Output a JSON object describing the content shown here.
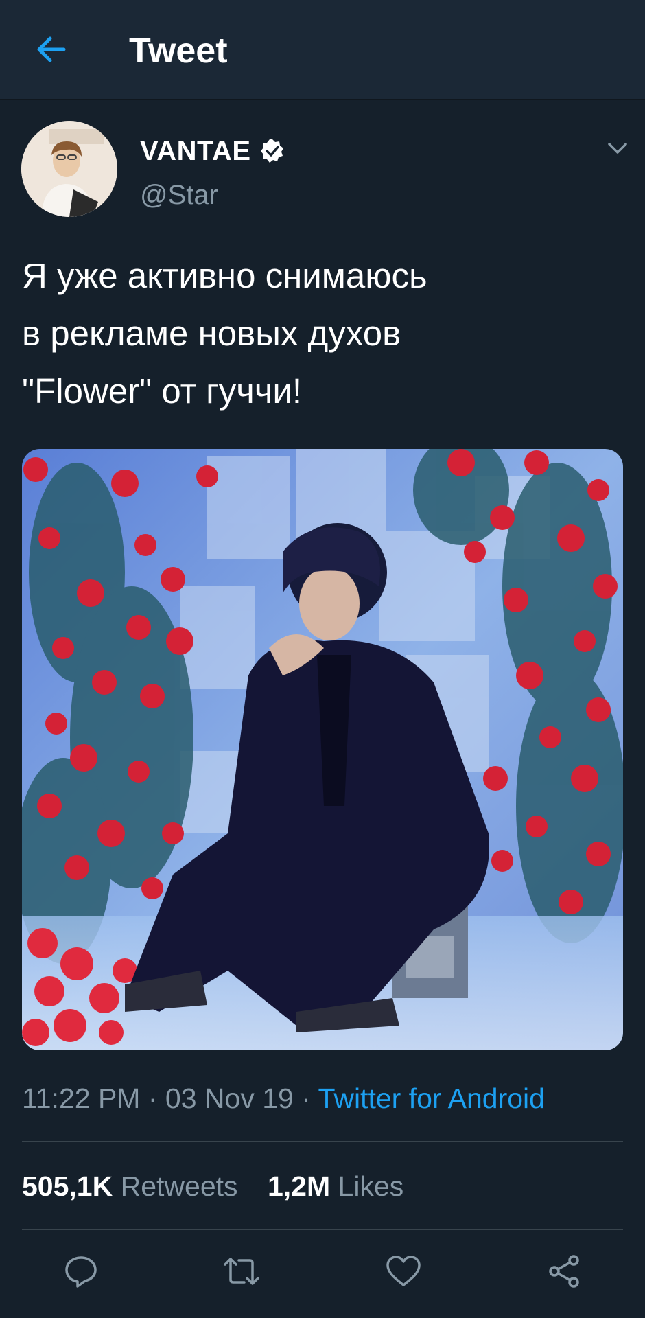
{
  "header": {
    "title": "Tweet",
    "back_icon": "arrow-left-icon"
  },
  "tweet": {
    "author": {
      "display_name": "VANTAE",
      "handle": "@Star",
      "verified": true,
      "avatar": "avatar-photo"
    },
    "text": "Я уже активно снимаюсь\nв рекламе новых духов\n\"Flower\" от гуччи!",
    "media": "photo-person-seated-among-red-roses",
    "time": "11:22 PM",
    "separator": "·",
    "date": "03 Nov 19",
    "source": "Twitter for Android",
    "stats": {
      "retweets_count": "505,1K",
      "retweets_label": "Retweets",
      "likes_count": "1,2M",
      "likes_label": "Likes"
    }
  },
  "actions": [
    {
      "name": "reply",
      "icon": "reply-icon"
    },
    {
      "name": "retweet",
      "icon": "retweet-icon"
    },
    {
      "name": "like",
      "icon": "heart-icon"
    },
    {
      "name": "share",
      "icon": "share-icon"
    }
  ],
  "colors": {
    "background": "#15202b",
    "header": "#1b2836",
    "accent": "#1da1f2",
    "secondary_text": "#8899a6",
    "divider": "#38444d"
  }
}
